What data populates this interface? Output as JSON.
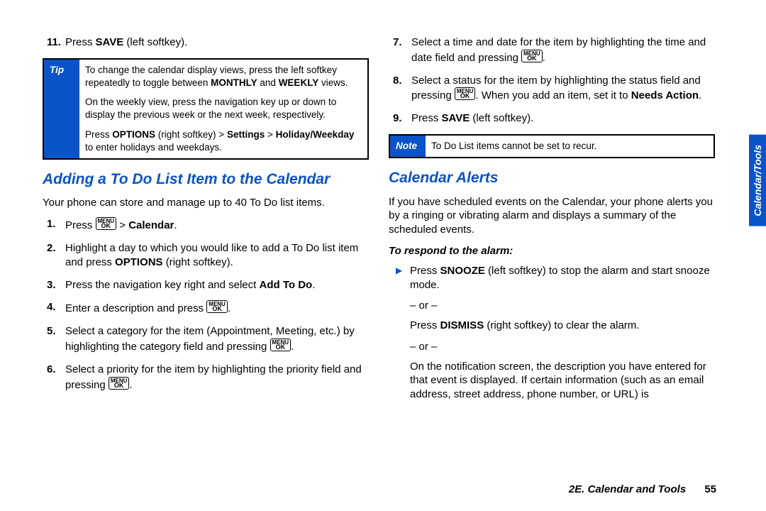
{
  "left": {
    "step11_pre": "Press ",
    "step11_b": "SAVE",
    "step11_post": " (left softkey).",
    "tip_label": "Tip",
    "tip_p1a": "To change the calendar display views, press the left softkey repeatedly to toggle between ",
    "tip_p1b": "MONTHLY",
    "tip_p1c": " and ",
    "tip_p1d": "WEEKLY",
    "tip_p1e": " views.",
    "tip_p2": "On the weekly view, press the navigation key up or down to display the previous week or the next week, respectively.",
    "tip_p3a": "Press ",
    "tip_p3b": "OPTIONS",
    "tip_p3c": " (right softkey) > ",
    "tip_p3d": "Settings",
    "tip_p3e": " > ",
    "tip_p3f": "Holiday/Weekday",
    "tip_p3g": " to enter holidays and weekdays.",
    "heading": "Adding a To Do List Item to the Calendar",
    "intro": "Your phone can store and manage up to 40 To Do list items.",
    "s1a": "Press ",
    "s1b": " > ",
    "s1c": "Calendar",
    "s1d": ".",
    "s2a": "Highlight a day to which you would like to add a To Do list item and press ",
    "s2b": "OPTIONS",
    "s2c": " (right softkey).",
    "s3a": "Press the navigation key right and select ",
    "s3b": "Add To Do",
    "s3c": ".",
    "s4a": "Enter a description and press ",
    "s4b": ".",
    "s5a": "Select a category for the item (Appointment, Meeting, etc.) by highlighting the category field and pressing ",
    "s5b": ".",
    "s6a": "Select a priority for the item by highlighting the priority field and pressing ",
    "s6b": "."
  },
  "right": {
    "s7a": "Select a time and date for the item by highlighting the time and date field and pressing ",
    "s7b": ".",
    "s8a": "Select a status for the item by highlighting the status field and pressing ",
    "s8b": ". When you add an item, set it to ",
    "s8c": "Needs Action",
    "s8d": ".",
    "s9a": "Press ",
    "s9b": "SAVE",
    "s9c": " (left softkey).",
    "note_label": "Note",
    "note_body": "To Do List items cannot be set to recur.",
    "heading": "Calendar Alerts",
    "intro": "If you have scheduled events on the Calendar, your phone alerts you by a ringing or vibrating alarm and displays a summary of the scheduled events.",
    "subh": "To respond to the alarm:",
    "b1a": "Press ",
    "b1b": "SNOOZE",
    "b1c": " (left softkey) to stop the alarm and start snooze mode.",
    "or1": "– or –",
    "b2a": "Press ",
    "b2b": "DISMISS",
    "b2c": " (right softkey) to clear the alarm.",
    "or2": "– or –",
    "b3": "On the notification screen, the description you have entered for that event is displayed. If certain information (such as an email address, street address, phone number, or URL) is"
  },
  "sidetab": "Calendar/Tools",
  "footer_section": "2E. Calendar and Tools",
  "footer_page": "55",
  "menuok_top": "MENU",
  "menuok_bot": "OK",
  "n11": "11.",
  "n1": "1.",
  "n2": "2.",
  "n3": "3.",
  "n4": "4.",
  "n5": "5.",
  "n6": "6.",
  "n7": "7.",
  "n8": "8.",
  "n9": "9."
}
